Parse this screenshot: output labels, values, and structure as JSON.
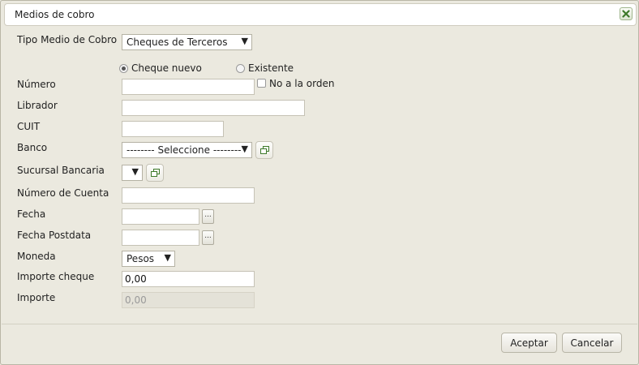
{
  "dialog": {
    "title": "Medios de cobro",
    "close_icon": "close-icon"
  },
  "form": {
    "tipo_medio": {
      "label": "Tipo Medio de Cobro",
      "value": "Cheques de Terceros"
    },
    "cheque_option": {
      "nuevo_label": "Cheque nuevo",
      "existente_label": "Existente",
      "selected": "Cheque nuevo"
    },
    "numero": {
      "label": "Número",
      "value": "",
      "no_orden_label": "No a la orden",
      "no_orden_checked": false
    },
    "librador": {
      "label": "Librador",
      "value": ""
    },
    "cuit": {
      "label": "CUIT",
      "value": ""
    },
    "banco": {
      "label": "Banco",
      "value": "-------- Seleccione --------"
    },
    "sucursal": {
      "label": "Sucursal Bancaria",
      "value": ""
    },
    "numero_cuenta": {
      "label": "Número de Cuenta",
      "value": ""
    },
    "fecha": {
      "label": "Fecha",
      "value": "",
      "picker_label": "..."
    },
    "fecha_postdata": {
      "label": "Fecha Postdata",
      "value": "",
      "picker_label": "..."
    },
    "moneda": {
      "label": "Moneda",
      "value": "Pesos"
    },
    "importe_cheque": {
      "label": "Importe cheque",
      "value": "0,00"
    },
    "importe": {
      "label": "Importe",
      "value": "0,00"
    }
  },
  "footer": {
    "accept_label": "Aceptar",
    "cancel_label": "Cancelar"
  },
  "colors": {
    "background": "#ebe9df",
    "close_icon_green": "#3d7a2a"
  }
}
